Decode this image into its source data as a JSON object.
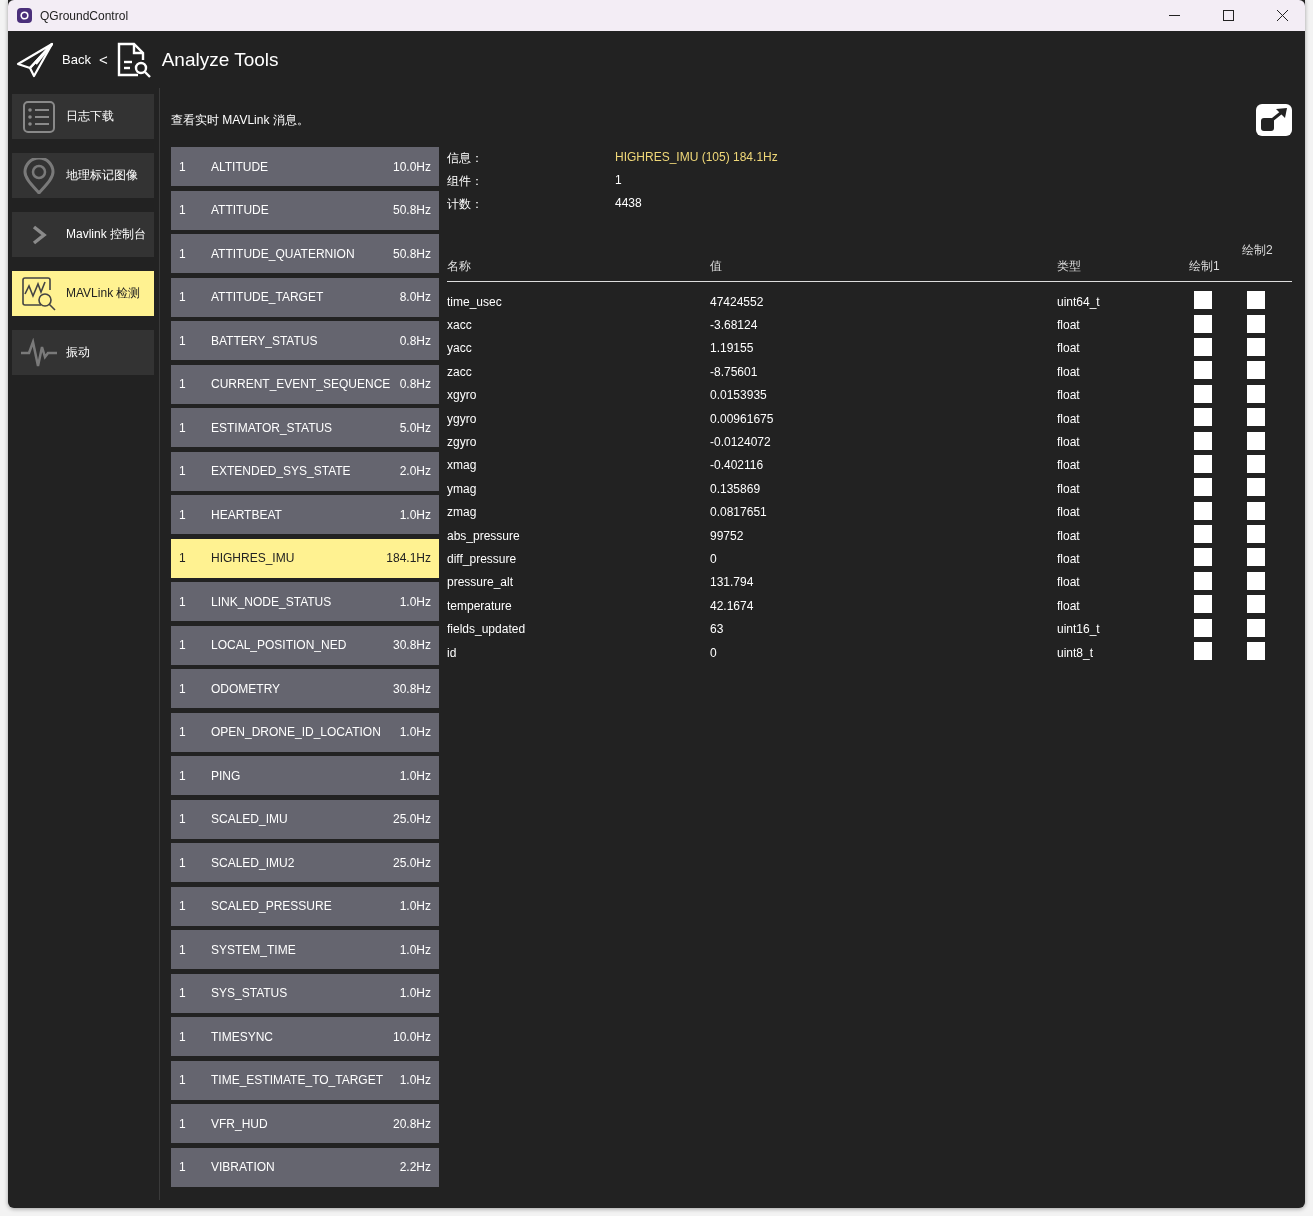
{
  "window": {
    "title": "QGroundControl"
  },
  "header": {
    "back": "Back",
    "separator": "<",
    "title": "Analyze Tools"
  },
  "sidebar": {
    "items": [
      {
        "label": "日志下载",
        "selected": false
      },
      {
        "label": "地理标记图像",
        "selected": false
      },
      {
        "label": "Mavlink 控制台",
        "selected": false
      },
      {
        "label": "MAVLink 检测",
        "selected": true
      },
      {
        "label": "振动",
        "selected": false
      }
    ]
  },
  "description": "查看实时 MAVLink 消息。",
  "messages": [
    {
      "component": "1",
      "name": "ALTITUDE",
      "rate": "10.0Hz",
      "selected": false
    },
    {
      "component": "1",
      "name": "ATTITUDE",
      "rate": "50.8Hz",
      "selected": false
    },
    {
      "component": "1",
      "name": "ATTITUDE_QUATERNION",
      "rate": "50.8Hz",
      "selected": false
    },
    {
      "component": "1",
      "name": "ATTITUDE_TARGET",
      "rate": "8.0Hz",
      "selected": false
    },
    {
      "component": "1",
      "name": "BATTERY_STATUS",
      "rate": "0.8Hz",
      "selected": false
    },
    {
      "component": "1",
      "name": "CURRENT_EVENT_SEQUENCE",
      "rate": "0.8Hz",
      "selected": false
    },
    {
      "component": "1",
      "name": "ESTIMATOR_STATUS",
      "rate": "5.0Hz",
      "selected": false
    },
    {
      "component": "1",
      "name": "EXTENDED_SYS_STATE",
      "rate": "2.0Hz",
      "selected": false
    },
    {
      "component": "1",
      "name": "HEARTBEAT",
      "rate": "1.0Hz",
      "selected": false
    },
    {
      "component": "1",
      "name": "HIGHRES_IMU",
      "rate": "184.1Hz",
      "selected": true
    },
    {
      "component": "1",
      "name": "LINK_NODE_STATUS",
      "rate": "1.0Hz",
      "selected": false
    },
    {
      "component": "1",
      "name": "LOCAL_POSITION_NED",
      "rate": "30.8Hz",
      "selected": false
    },
    {
      "component": "1",
      "name": "ODOMETRY",
      "rate": "30.8Hz",
      "selected": false
    },
    {
      "component": "1",
      "name": "OPEN_DRONE_ID_LOCATION",
      "rate": "1.0Hz",
      "selected": false
    },
    {
      "component": "1",
      "name": "PING",
      "rate": "1.0Hz",
      "selected": false
    },
    {
      "component": "1",
      "name": "SCALED_IMU",
      "rate": "25.0Hz",
      "selected": false
    },
    {
      "component": "1",
      "name": "SCALED_IMU2",
      "rate": "25.0Hz",
      "selected": false
    },
    {
      "component": "1",
      "name": "SCALED_PRESSURE",
      "rate": "1.0Hz",
      "selected": false
    },
    {
      "component": "1",
      "name": "SYSTEM_TIME",
      "rate": "1.0Hz",
      "selected": false
    },
    {
      "component": "1",
      "name": "SYS_STATUS",
      "rate": "1.0Hz",
      "selected": false
    },
    {
      "component": "1",
      "name": "TIMESYNC",
      "rate": "10.0Hz",
      "selected": false
    },
    {
      "component": "1",
      "name": "TIME_ESTIMATE_TO_TARGET",
      "rate": "1.0Hz",
      "selected": false
    },
    {
      "component": "1",
      "name": "VFR_HUD",
      "rate": "20.8Hz",
      "selected": false
    },
    {
      "component": "1",
      "name": "VIBRATION",
      "rate": "2.2Hz",
      "selected": false
    }
  ],
  "info": [
    {
      "label": "信息：",
      "value": "HIGHRES_IMU (105) 184.1Hz",
      "highlight": true
    },
    {
      "label": "组件：",
      "value": "1",
      "highlight": false
    },
    {
      "label": "计数：",
      "value": "4438",
      "highlight": false
    }
  ],
  "table": {
    "columns": [
      "名称",
      "值",
      "类型",
      "绘制1",
      "绘制2"
    ],
    "rows": [
      {
        "name": "time_usec",
        "value": "47424552",
        "type": "uint64_t",
        "plot1": false,
        "plot2": false
      },
      {
        "name": "xacc",
        "value": "-3.68124",
        "type": "float",
        "plot1": false,
        "plot2": false
      },
      {
        "name": "yacc",
        "value": "1.19155",
        "type": "float",
        "plot1": false,
        "plot2": false
      },
      {
        "name": "zacc",
        "value": "-8.75601",
        "type": "float",
        "plot1": false,
        "plot2": false
      },
      {
        "name": "xgyro",
        "value": "0.0153935",
        "type": "float",
        "plot1": false,
        "plot2": false
      },
      {
        "name": "ygyro",
        "value": "0.00961675",
        "type": "float",
        "plot1": false,
        "plot2": false
      },
      {
        "name": "zgyro",
        "value": "-0.0124072",
        "type": "float",
        "plot1": false,
        "plot2": false
      },
      {
        "name": "xmag",
        "value": "-0.402116",
        "type": "float",
        "plot1": false,
        "plot2": false
      },
      {
        "name": "ymag",
        "value": "0.135869",
        "type": "float",
        "plot1": false,
        "plot2": false
      },
      {
        "name": "zmag",
        "value": "0.0817651",
        "type": "float",
        "plot1": false,
        "plot2": false
      },
      {
        "name": "abs_pressure",
        "value": "99752",
        "type": "float",
        "plot1": false,
        "plot2": false
      },
      {
        "name": "diff_pressure",
        "value": "0",
        "type": "float",
        "plot1": false,
        "plot2": false
      },
      {
        "name": "pressure_alt",
        "value": "131.794",
        "type": "float",
        "plot1": false,
        "plot2": false
      },
      {
        "name": "temperature",
        "value": "42.1674",
        "type": "float",
        "plot1": false,
        "plot2": false
      },
      {
        "name": "fields_updated",
        "value": "63",
        "type": "uint16_t",
        "plot1": false,
        "plot2": false
      },
      {
        "name": "id",
        "value": "0",
        "type": "uint8_t",
        "plot1": false,
        "plot2": false
      }
    ]
  }
}
